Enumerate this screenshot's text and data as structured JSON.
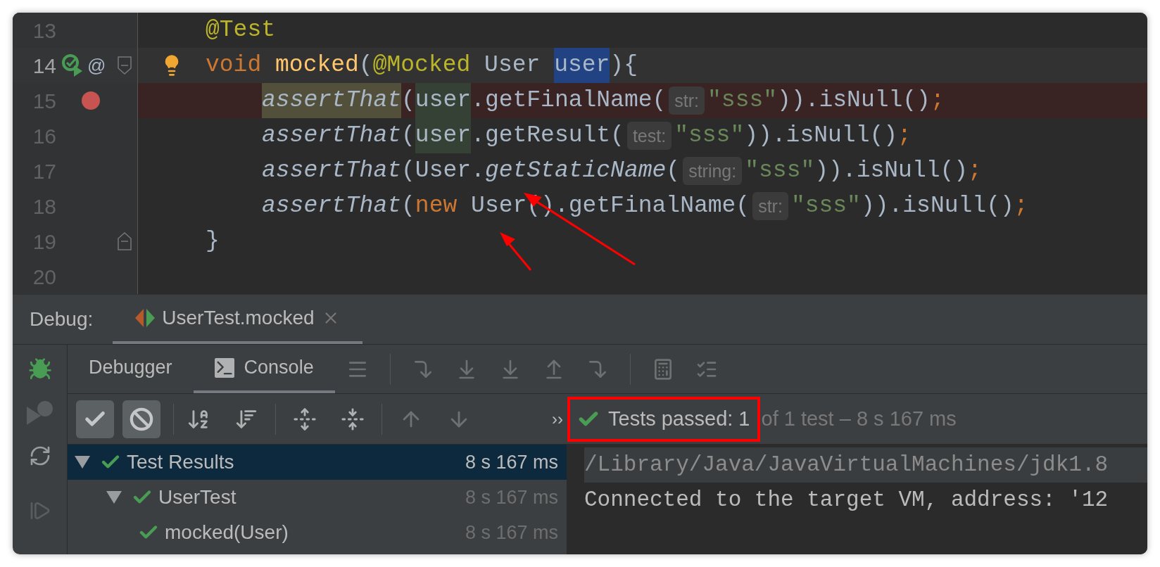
{
  "editor": {
    "lines": [
      {
        "number": "13",
        "current": false,
        "breakpoint": false,
        "indented": false,
        "tokens": [
          {
            "text": "@Test",
            "kind": "annotation"
          }
        ]
      },
      {
        "number": "14",
        "current": true,
        "breakpoint": false,
        "indented": false,
        "run_icon": true,
        "marker": "@",
        "fold_start": true,
        "bulb": true,
        "tokens": [
          {
            "text": "void ",
            "kind": "keyword"
          },
          {
            "text": "mocked",
            "kind": "method-decl"
          },
          {
            "text": "(",
            "kind": "plain"
          },
          {
            "text": "@Mocked",
            "kind": "annotation"
          },
          {
            "text": " User ",
            "kind": "plain"
          },
          {
            "text": "user",
            "kind": "plain",
            "color": "#214283"
          },
          {
            "text": "){",
            "kind": "plain"
          }
        ]
      },
      {
        "number": "15",
        "current": false,
        "breakpoint": true,
        "indented": true,
        "tokens": [
          {
            "text": "assertThat",
            "kind": "static",
            "color": "#52503a"
          },
          {
            "text": "(",
            "kind": "plain"
          },
          {
            "text": "user",
            "kind": "plain",
            "color": "#344134"
          },
          {
            "text": ".getFinalName(",
            "kind": "plain"
          },
          {
            "text": "str:",
            "kind": "hint"
          },
          {
            "text": "\"sss\"",
            "kind": "string"
          },
          {
            "text": ")).isNull()",
            "kind": "plain"
          },
          {
            "text": ";",
            "kind": "semicolon"
          }
        ]
      },
      {
        "number": "16",
        "current": false,
        "breakpoint": false,
        "indented": true,
        "tokens": [
          {
            "text": "assertThat",
            "kind": "static"
          },
          {
            "text": "(",
            "kind": "plain"
          },
          {
            "text": "user",
            "kind": "plain",
            "color": "#344134"
          },
          {
            "text": ".getResult(",
            "kind": "plain"
          },
          {
            "text": "test:",
            "kind": "hint"
          },
          {
            "text": "\"sss\"",
            "kind": "string"
          },
          {
            "text": ")).isNull()",
            "kind": "plain"
          },
          {
            "text": ";",
            "kind": "semicolon"
          }
        ]
      },
      {
        "number": "17",
        "current": false,
        "breakpoint": false,
        "indented": true,
        "tokens": [
          {
            "text": "assertThat",
            "kind": "static"
          },
          {
            "text": "(User.",
            "kind": "plain"
          },
          {
            "text": "getStaticName",
            "kind": "static"
          },
          {
            "text": "(",
            "kind": "plain"
          },
          {
            "text": "string:",
            "kind": "hint"
          },
          {
            "text": "\"sss\"",
            "kind": "string"
          },
          {
            "text": ")).isNull()",
            "kind": "plain"
          },
          {
            "text": ";",
            "kind": "semicolon"
          }
        ]
      },
      {
        "number": "18",
        "current": false,
        "breakpoint": false,
        "indented": true,
        "tokens": [
          {
            "text": "assertThat",
            "kind": "static"
          },
          {
            "text": "(",
            "kind": "plain"
          },
          {
            "text": "new",
            "kind": "keyword"
          },
          {
            "text": " User().getFinalName(",
            "kind": "plain"
          },
          {
            "text": "str:",
            "kind": "hint"
          },
          {
            "text": "\"sss\"",
            "kind": "string"
          },
          {
            "text": ")).isNull()",
            "kind": "plain"
          },
          {
            "text": ";",
            "kind": "semicolon"
          }
        ]
      },
      {
        "number": "19",
        "current": false,
        "breakpoint": false,
        "indented": false,
        "fold_end": true,
        "tokens": [
          {
            "text": "}",
            "kind": "plain"
          }
        ]
      },
      {
        "number": "20",
        "current": false,
        "breakpoint": false,
        "indented": false
      }
    ]
  },
  "debug": {
    "label": "Debug:",
    "session_tab": {
      "label": "UserTest.mocked",
      "selected": true
    },
    "tabs": [
      {
        "label": "Debugger",
        "selected": false,
        "icon": false
      },
      {
        "label": "Console",
        "selected": true,
        "icon": true
      }
    ],
    "filters": [
      {
        "kind": "passed",
        "on": true
      },
      {
        "kind": "ignored",
        "on": true
      }
    ],
    "more": "››",
    "status": {
      "passed": "Tests passed: 1",
      "rest": "of 1 test – 8 s 167 ms"
    },
    "tree": [
      {
        "label": "Test Results",
        "duration": "8 s 167 ms",
        "selected": true,
        "expanded": true,
        "children": [
          {
            "label": "UserTest",
            "duration": "8 s 167 ms",
            "selected": false,
            "expanded": true,
            "children": [
              {
                "label": "mocked(User)",
                "duration": "8 s 167 ms",
                "selected": false
              }
            ]
          }
        ]
      }
    ],
    "console": [
      {
        "text": "/Library/Java/JavaVirtualMachines/jdk1.8",
        "kind": "command"
      },
      {
        "text": "Connected to the target VM, address: '12",
        "kind": "output"
      }
    ]
  }
}
